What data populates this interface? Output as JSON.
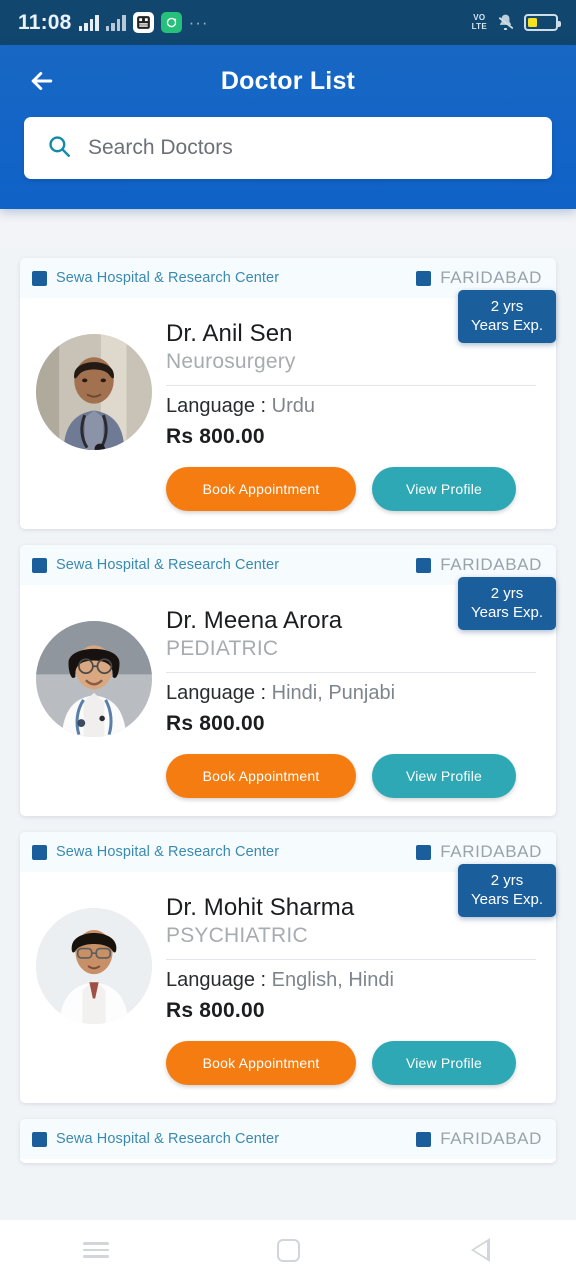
{
  "status_bar": {
    "time": "11:08",
    "volte_line1": "VO",
    "volte_line2": "LTE",
    "icons": [
      "signal-bars-icon",
      "signal-bars-dim-icon",
      "whatsapp-icon",
      "green-app-icon",
      "overflow-dots-icon",
      "volte-icon",
      "mute-bell-icon",
      "battery-icon"
    ],
    "battery_percent": "36"
  },
  "app_bar": {
    "title": "Doctor List",
    "back_label": "back-arrow"
  },
  "search": {
    "placeholder": "Search Doctors",
    "value": "",
    "icon": "search-icon"
  },
  "doctors": [
    {
      "hospital": "Sewa Hospital & Research Center",
      "city": "FARIDABAD",
      "experience_line1": "2 yrs",
      "experience_line2": "Years Exp.",
      "name": "Dr. Anil Sen",
      "specialty": "Neurosurgery",
      "language_label": "Language : ",
      "language_value": "Urdu",
      "fee": "Rs 800.00",
      "book_label": "Book Appointment",
      "view_label": "View Profile",
      "avatar": "male-doctor-blue-shirt-stethoscope"
    },
    {
      "hospital": "Sewa Hospital & Research Center",
      "city": "FARIDABAD",
      "experience_line1": "2 yrs",
      "experience_line2": "Years Exp.",
      "name": "Dr. Meena Arora",
      "specialty": "PEDIATRIC",
      "language_label": "Language : ",
      "language_value": "Hindi, Punjabi",
      "fee": "Rs 800.00",
      "book_label": "Book Appointment",
      "view_label": "View Profile",
      "avatar": "female-doctor-glasses-white-coat"
    },
    {
      "hospital": "Sewa Hospital & Research Center",
      "city": "FARIDABAD",
      "experience_line1": "2 yrs",
      "experience_line2": "Years Exp.",
      "name": "Dr. Mohit Sharma",
      "specialty": "PSYCHIATRIC",
      "language_label": "Language : ",
      "language_value": "English, Hindi",
      "fee": "Rs 800.00",
      "book_label": "Book Appointment",
      "view_label": "View Profile",
      "avatar": "male-doctor-glasses-white-coat"
    }
  ],
  "partial_card": {
    "hospital": "Sewa Hospital & Research Center",
    "city": "FARIDABAD"
  },
  "nav_bar": {
    "recents": "recents-icon",
    "home": "home-icon",
    "back": "back-icon"
  },
  "colors": {
    "header_blue": "#0f62c7",
    "status_bar": "#11476f",
    "accent_orange": "#f57c11",
    "accent_teal": "#2ea8b5",
    "badge_blue": "#1a5f9c",
    "hospital_text": "#3a8ab0",
    "page_bg": "#f1f4f7"
  }
}
